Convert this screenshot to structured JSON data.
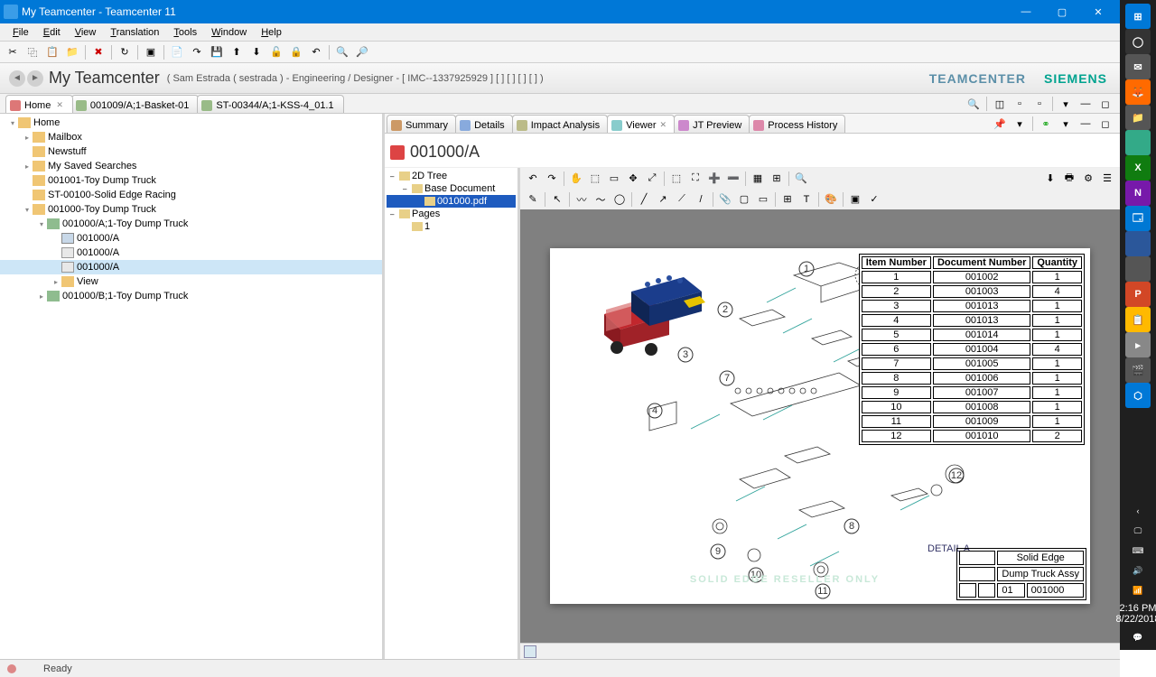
{
  "window": {
    "title": "My Teamcenter - Teamcenter 11"
  },
  "menu": [
    "File",
    "Edit",
    "View",
    "Translation",
    "Tools",
    "Window",
    "Help"
  ],
  "titleStrip": {
    "heading": "My Teamcenter",
    "sub": "( Sam Estrada ( sestrada ) - Engineering / Designer - [ IMC--1337925929 ] [ ] [ ] [ ] [ ] )",
    "brand1": "TEAMCENTER",
    "brand2": "SIEMENS"
  },
  "navTabs": [
    {
      "label": "Home",
      "icon": "#d77",
      "active": true,
      "closable": true
    },
    {
      "label": "001009/A;1-Basket-01",
      "icon": "#9b8",
      "active": false
    },
    {
      "label": "ST-00344/A;1-KSS-4_01.1",
      "icon": "#9b8",
      "active": false
    }
  ],
  "tree": [
    {
      "d": 0,
      "ico": "fold",
      "exp": "▾",
      "label": "Home"
    },
    {
      "d": 1,
      "ico": "fold",
      "exp": "▸",
      "label": "Mailbox"
    },
    {
      "d": 1,
      "ico": "fold",
      "exp": "",
      "label": "Newstuff"
    },
    {
      "d": 1,
      "ico": "fold",
      "exp": "▸",
      "label": "My Saved Searches"
    },
    {
      "d": 1,
      "ico": "fold",
      "exp": "",
      "label": "001001-Toy Dump Truck"
    },
    {
      "d": 1,
      "ico": "fold",
      "exp": "",
      "label": "ST-00100-Solid Edge Racing"
    },
    {
      "d": 1,
      "ico": "fold",
      "exp": "▾",
      "label": "001000-Toy Dump Truck"
    },
    {
      "d": 2,
      "ico": "fold green",
      "exp": "▾",
      "label": "001000/A;1-Toy Dump Truck"
    },
    {
      "d": 3,
      "ico": "cube",
      "exp": "",
      "label": "001000/A"
    },
    {
      "d": 3,
      "ico": "doc",
      "exp": "",
      "label": "001000/A"
    },
    {
      "d": 3,
      "ico": "doc",
      "exp": "",
      "label": "001000/A",
      "sel": true
    },
    {
      "d": 3,
      "ico": "fold",
      "exp": "▸",
      "label": "View"
    },
    {
      "d": 2,
      "ico": "fold green",
      "exp": "▸",
      "label": "001000/B;1-Toy Dump Truck"
    }
  ],
  "viewTabs": [
    {
      "label": "Summary",
      "icon": "#c96"
    },
    {
      "label": "Details",
      "icon": "#8ad"
    },
    {
      "label": "Impact Analysis",
      "icon": "#bb8"
    },
    {
      "label": "Viewer",
      "icon": "#8cc",
      "active": true,
      "closable": true
    },
    {
      "label": "JT Preview",
      "icon": "#c8c"
    },
    {
      "label": "Process History",
      "icon": "#d8a"
    }
  ],
  "docTitle": "001000/A",
  "vtree": [
    {
      "d": 0,
      "label": "2D Tree",
      "exp": "–"
    },
    {
      "d": 1,
      "label": "Base Document",
      "exp": "–"
    },
    {
      "d": 2,
      "label": "001000.pdf",
      "sel": true
    },
    {
      "d": 0,
      "label": "Pages",
      "exp": "–"
    },
    {
      "d": 1,
      "label": "1"
    }
  ],
  "bom": {
    "headers": [
      "Item Number",
      "Document Number",
      "Quantity"
    ],
    "rows": [
      [
        "1",
        "001002",
        "1"
      ],
      [
        "2",
        "001003",
        "4"
      ],
      [
        "3",
        "001013",
        "1"
      ],
      [
        "4",
        "001013",
        "1"
      ],
      [
        "5",
        "001014",
        "1"
      ],
      [
        "6",
        "001004",
        "4"
      ],
      [
        "7",
        "001005",
        "1"
      ],
      [
        "8",
        "001006",
        "1"
      ],
      [
        "9",
        "001007",
        "1"
      ],
      [
        "10",
        "001008",
        "1"
      ],
      [
        "11",
        "001009",
        "1"
      ],
      [
        "12",
        "001010",
        "2"
      ]
    ]
  },
  "drawing": {
    "watermark": "SOLID EDGE RESELLER ONLY",
    "detail": "DETAIL A",
    "titleblock": {
      "company": "Solid Edge",
      "title": "Dump Truck Assy",
      "docnum": "001000",
      "rev": "01"
    }
  },
  "status": "Ready",
  "clock": {
    "time": "2:16 PM",
    "date": "8/22/2018"
  },
  "taskApps": [
    {
      "c": "#0078d7",
      "t": "⊞"
    },
    {
      "c": "#333",
      "t": "◯"
    },
    {
      "c": "#555",
      "t": "✉"
    },
    {
      "c": "#ff6a00",
      "t": "🦊"
    },
    {
      "c": "#555",
      "t": "📁"
    },
    {
      "c": "#3a8",
      "t": ""
    },
    {
      "c": "#107c10",
      "t": "X"
    },
    {
      "c": "#7719aa",
      "t": "N"
    },
    {
      "c": "#0078d4",
      "t": "🗔"
    },
    {
      "c": "#2b579a",
      "t": ""
    },
    {
      "c": "#555",
      "t": ""
    },
    {
      "c": "#d24726",
      "t": "P"
    },
    {
      "c": "#ffb900",
      "t": "📋"
    },
    {
      "c": "#888",
      "t": "▸"
    },
    {
      "c": "#555",
      "t": "🎬"
    },
    {
      "c": "#0078d7",
      "t": "⬡"
    }
  ]
}
